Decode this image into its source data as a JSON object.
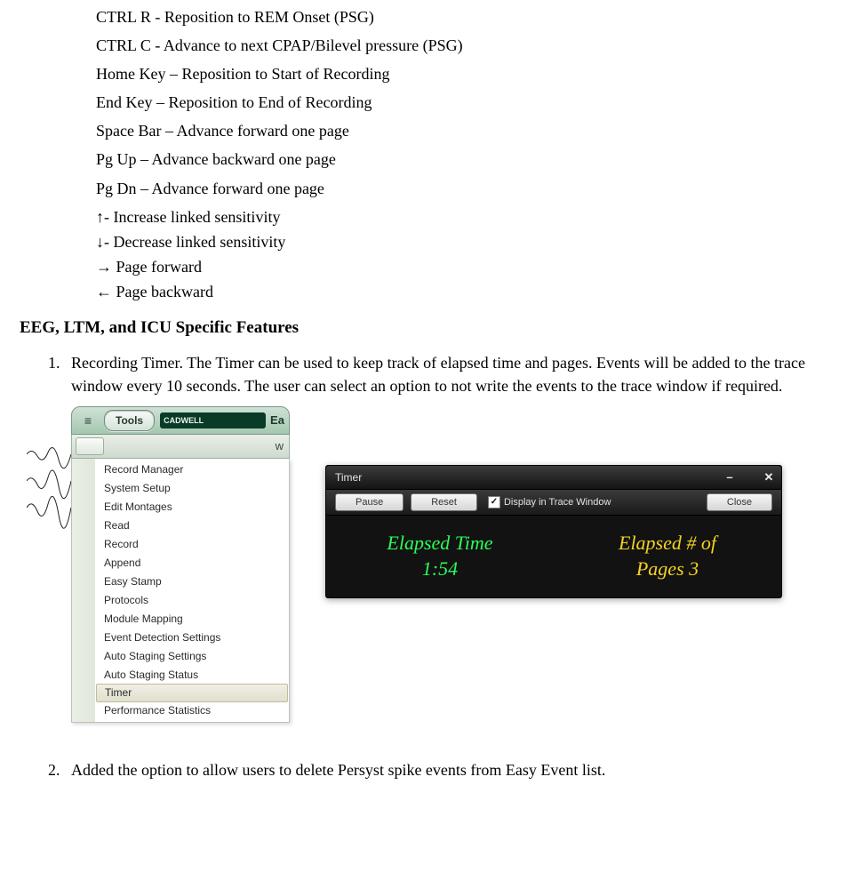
{
  "shortcuts": [
    "CTRL R - Reposition to REM Onset (PSG)",
    "CTRL C - Advance to next CPAP/Bilevel pressure (PSG)",
    "Home Key – Reposition to Start of Recording",
    "End Key – Reposition to End of Recording",
    "Space Bar – Advance forward one page",
    "Pg Up – Advance backward one page",
    "Pg Dn – Advance forward one page"
  ],
  "shortcuts_tight": [
    "↑- Increase linked sensitivity",
    "↓- Decrease linked sensitivity",
    "→ Page forward",
    "← Page backward"
  ],
  "section_heading": "EEG, LTM, and ICU Specific Features",
  "feature1_text": "Recording Timer.  The Timer can be used to keep track of elapsed time and pages.   Events will be added to the trace window every 10 seconds.  The user can select an option to not write the events to the trace window if required.",
  "feature2_text": "Added the option to allow users to delete Persyst spike events from Easy Event list.",
  "tools_menu": {
    "button": "Tools",
    "brand": "CADWELL",
    "right_frag": "Ea",
    "sub_w": "w",
    "items": [
      "Record Manager",
      "System Setup",
      "Edit Montages",
      "Read",
      "Record",
      "Append",
      "Easy Stamp",
      "Protocols",
      "Module Mapping",
      "Event Detection Settings",
      "Auto Staging Settings",
      "Auto Staging Status",
      "Timer",
      "Performance Statistics"
    ],
    "highlighted_index": 12
  },
  "timer_window": {
    "title": "Timer",
    "buttons": {
      "pause": "Pause",
      "reset": "Reset",
      "close": "Close"
    },
    "checkbox_label": "Display in Trace Window",
    "checkbox_checked": true,
    "elapsed_time_label": "Elapsed Time",
    "elapsed_time_value": "1:54",
    "elapsed_pages_label": "Elapsed # of",
    "elapsed_pages_value": "Pages  3"
  }
}
